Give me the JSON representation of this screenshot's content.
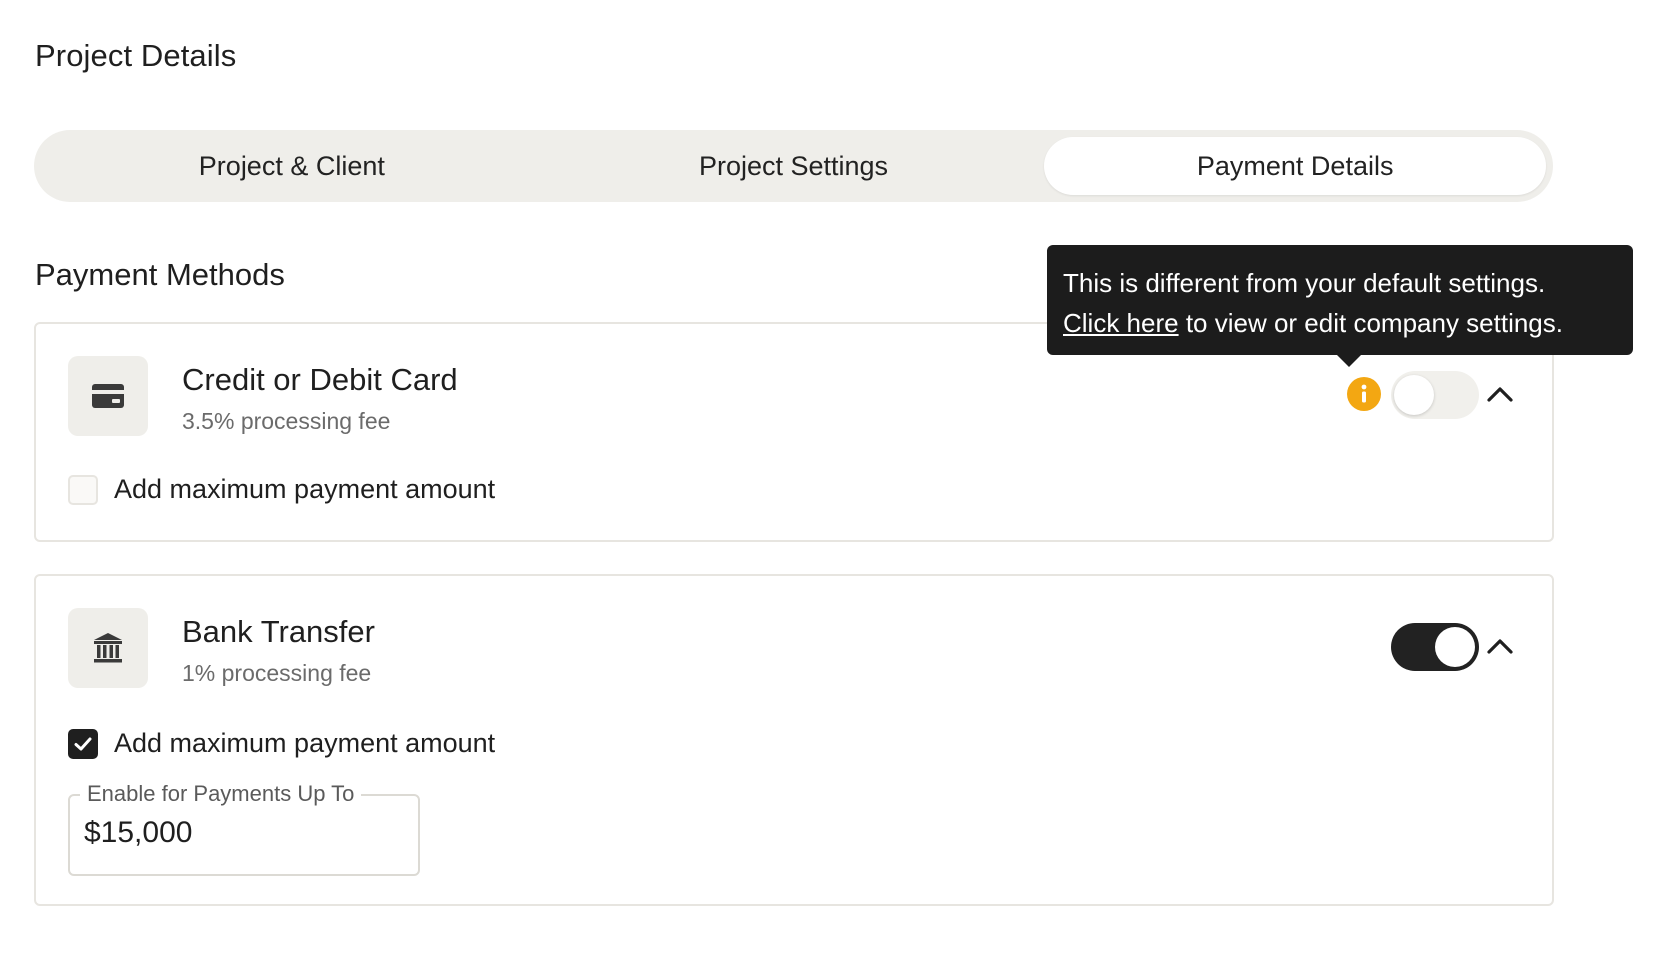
{
  "page": {
    "title": "Project Details"
  },
  "tabs": [
    {
      "label": "Project & Client",
      "active": false
    },
    {
      "label": "Project Settings",
      "active": false
    },
    {
      "label": "Payment Details",
      "active": true
    }
  ],
  "payment_methods": {
    "title": "Payment Methods",
    "tooltip": {
      "line1": "This is different from your default settings.",
      "link": "Click here",
      "line2_rest": " to view or edit company settings."
    },
    "methods": [
      {
        "name": "Credit or Debit Card",
        "fee": "3.5% processing fee",
        "icon": "credit-card-icon",
        "enabled": false,
        "checkbox_label": "Add maximum payment amount",
        "max_amount_checked": false,
        "has_info_warning": true,
        "warning_color": "#f3a712"
      },
      {
        "name": "Bank Transfer",
        "fee": "1% processing fee",
        "icon": "bank-icon",
        "enabled": true,
        "checkbox_label": "Add maximum payment amount",
        "max_amount_checked": true,
        "max_amount_field": {
          "label": "Enable for Payments Up To",
          "value": "$15,000"
        }
      }
    ]
  },
  "colors": {
    "tab_track": "#efeeea",
    "toggle_on": "#222222",
    "warning": "#f3a712"
  }
}
